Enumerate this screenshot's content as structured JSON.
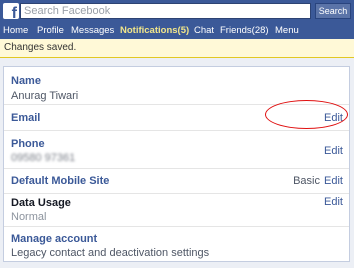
{
  "header": {
    "search_placeholder": "Search Facebook",
    "search_button": "Search",
    "logo_letter": "f",
    "brand_color": "#3b5998"
  },
  "nav": {
    "items": [
      "Home",
      "Profile",
      "Messages",
      "Notifications(5)",
      "Chat",
      "Friends(28)",
      "Menu"
    ],
    "active": "Notifications(5)"
  },
  "notice": {
    "text": "Changes saved."
  },
  "settings": {
    "name": {
      "title": "Name",
      "value": "Anurag Tiwari"
    },
    "email": {
      "title": "Email",
      "edit": "Edit"
    },
    "phone": {
      "title": "Phone",
      "value": "09580 97361",
      "edit": "Edit"
    },
    "default_site": {
      "title": "Default Mobile Site",
      "value": "Basic",
      "edit": "Edit"
    },
    "data_usage": {
      "title": "Data Usage",
      "value": "Normal",
      "edit": "Edit"
    },
    "manage_account": {
      "title": "Manage account",
      "subtitle": "Legacy contact and deactivation settings"
    }
  },
  "annotation_color": "#e01010"
}
